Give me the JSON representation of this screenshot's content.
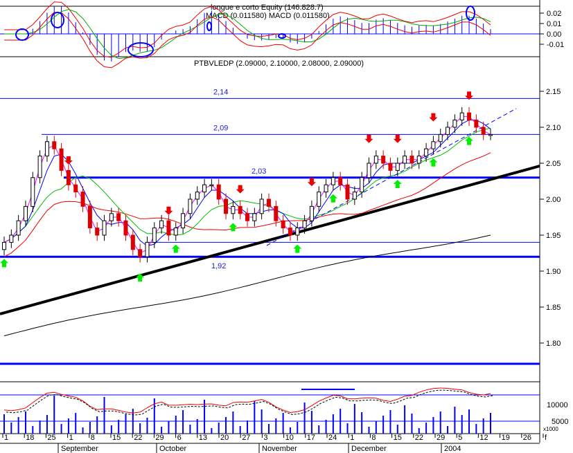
{
  "colors": {
    "blue_line": "#0000ff",
    "red": "#ee0000",
    "green": "#00cc00",
    "magenta": "#ff00ff",
    "black": "#000000",
    "grid": "#000000"
  },
  "macd_panel": {
    "title_line1": "longue e corto Equity (146.828.7)",
    "title_line2": "MACD (0.011580) MACD (0.011580)",
    "y_ticks": [
      "0.02",
      "0.01",
      "0.00",
      "-0.01"
    ]
  },
  "price_panel": {
    "title": "PTBVLEDP (2.09000, 2.10000, 2.08000, 2.09000)",
    "level_labels": [
      "2,14",
      "2,09",
      "2,03",
      "1,92"
    ],
    "y_ticks": [
      "2.15",
      "2.10",
      "2.05",
      "2.00",
      "1.95",
      "1.90",
      "1.85",
      "1.80"
    ]
  },
  "volume_panel": {
    "y_ticks": [
      "10000",
      "5000"
    ],
    "multiplier": "x1000"
  },
  "x_axis": {
    "day_ticks": [
      "1",
      "18",
      "25",
      "1",
      "8",
      "15",
      "22",
      "29",
      "6",
      "13",
      "20",
      "27",
      "3",
      "10",
      "17",
      "24",
      "1",
      "8",
      "15",
      "22",
      "29",
      "5",
      "12",
      "19",
      "26",
      "f"
    ],
    "months": [
      "September",
      "October",
      "November",
      "December",
      "2004"
    ]
  },
  "chart_data": {
    "type": "candlestick",
    "title": "PTBVLEDP (2.09000, 2.10000, 2.08000, 2.09000)",
    "symbol": "PTBVLEDP",
    "last_ohlc": {
      "open": 2.09,
      "high": 2.1,
      "low": 2.08,
      "close": 2.09
    },
    "ylim": [
      1.79,
      2.18
    ],
    "horizontal_levels": [
      2.14,
      2.09,
      2.03,
      1.92
    ],
    "closes": [
      1.94,
      1.95,
      1.97,
      1.99,
      2.03,
      2.06,
      2.08,
      2.07,
      2.04,
      2.02,
      2.01,
      1.99,
      1.96,
      1.95,
      1.97,
      1.98,
      1.97,
      1.95,
      1.93,
      1.92,
      1.94,
      1.96,
      1.97,
      1.95,
      1.96,
      1.98,
      2.0,
      2.01,
      2.02,
      2.02,
      2.0,
      1.98,
      1.99,
      1.98,
      1.97,
      1.98,
      2.0,
      1.99,
      1.97,
      1.96,
      1.95,
      1.96,
      1.97,
      1.99,
      2.01,
      2.02,
      2.03,
      2.02,
      2.0,
      2.01,
      2.03,
      2.05,
      2.06,
      2.05,
      2.04,
      2.05,
      2.06,
      2.05,
      2.06,
      2.07,
      2.08,
      2.09,
      2.1,
      2.11,
      2.12,
      2.11,
      2.1,
      2.09,
      2.09
    ],
    "volume_ticks_k": [
      10000,
      5000
    ],
    "macd_ticks": [
      0.02,
      0.01,
      0.0,
      -0.01
    ]
  }
}
